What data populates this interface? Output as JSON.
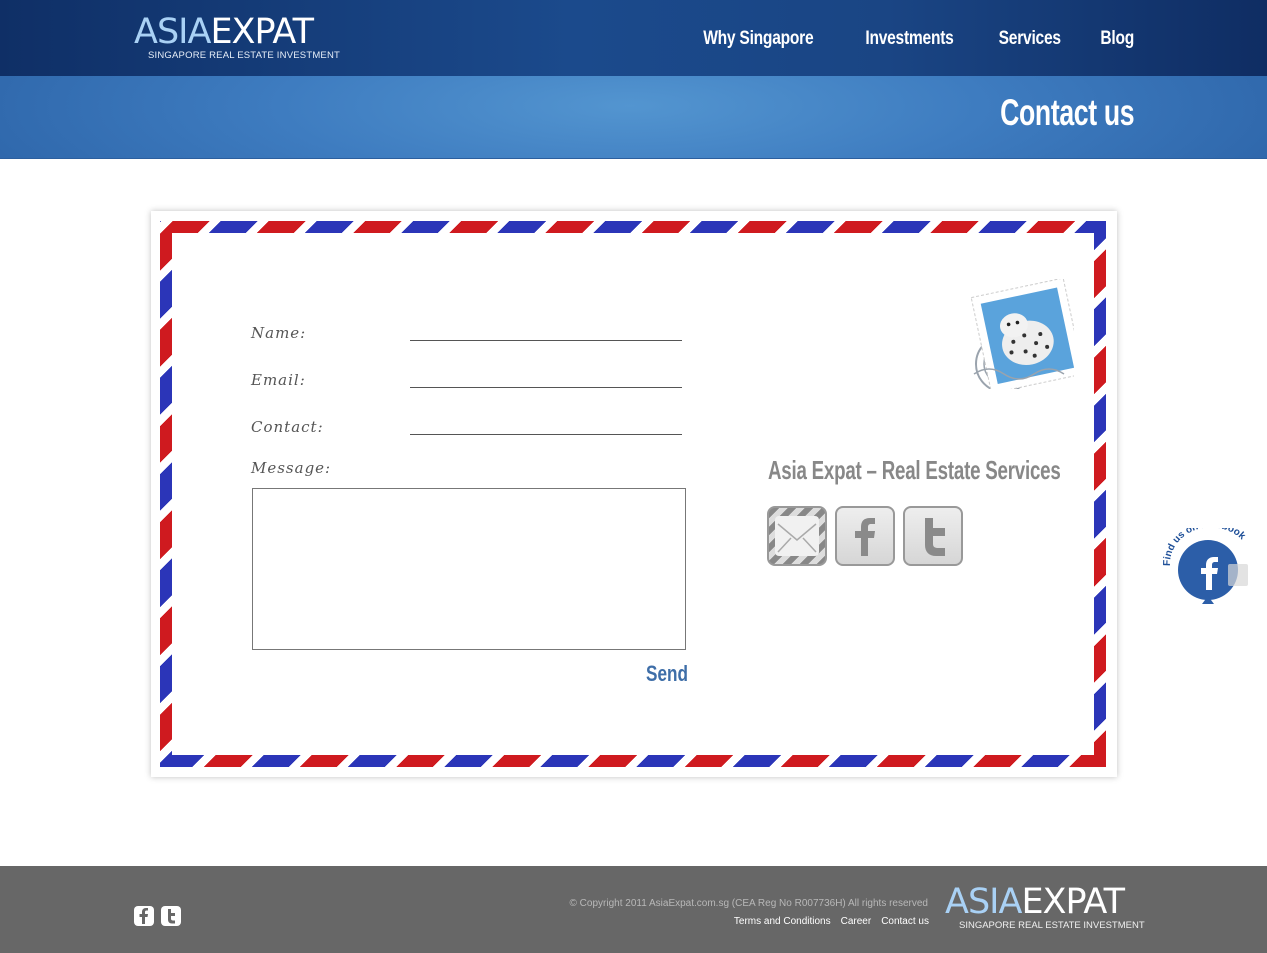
{
  "brand": {
    "logo_asia": "ASIA",
    "logo_expat": "EXPAT",
    "tagline": "SINGAPORE REAL ESTATE INVESTMENT"
  },
  "nav": {
    "items": [
      {
        "label": "Why Singapore"
      },
      {
        "label": "Investments"
      },
      {
        "label": "Services"
      },
      {
        "label": "Blog"
      }
    ]
  },
  "page": {
    "title": "Contact us"
  },
  "form": {
    "name_label": "Name:",
    "email_label": "Email:",
    "contact_label": "Contact:",
    "message_label": "Message:",
    "send_label": "Send"
  },
  "contact_panel": {
    "company": "Asia Expat – Real Estate Services",
    "icons": [
      "mail-icon",
      "facebook-icon",
      "twitter-icon"
    ]
  },
  "facebook_badge": {
    "text": "Find us on facebook"
  },
  "footer": {
    "copyright": "© Copyright 2011 AsiaExpat.com.sg (CEA Reg No R007736H) All rights reserved",
    "links": [
      {
        "label": "Terms and Conditions"
      },
      {
        "label": "Career"
      },
      {
        "label": "Contact us"
      }
    ]
  },
  "colors": {
    "header": "#1b4a8c",
    "banner": "#4a8ac8",
    "stripe_red": "#cf1a1f",
    "stripe_blue": "#2b35b8",
    "send": "#3e6ea8",
    "footer": "#676767"
  }
}
